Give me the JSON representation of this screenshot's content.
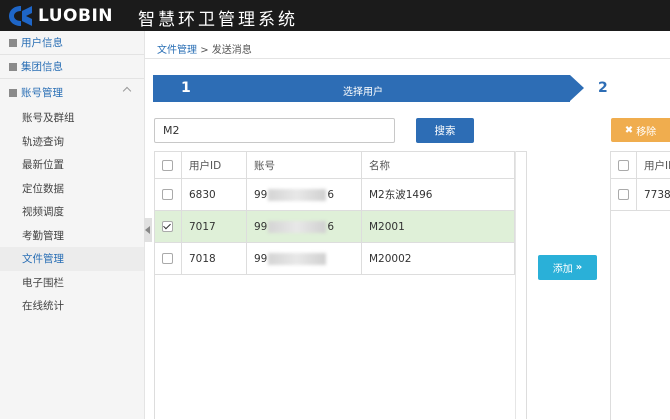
{
  "header": {
    "brand": "LUOBIN",
    "title": "智慧环卫管理系统"
  },
  "sidebar": {
    "top_items": [
      {
        "label": "用户信息"
      },
      {
        "label": "集团信息"
      }
    ],
    "group": {
      "label": "账号管理"
    },
    "items": [
      {
        "label": "账号及群组"
      },
      {
        "label": "轨迹查询"
      },
      {
        "label": "最新位置"
      },
      {
        "label": "定位数据"
      },
      {
        "label": "视频调度"
      },
      {
        "label": "考勤管理"
      },
      {
        "label": "文件管理"
      },
      {
        "label": "电子围栏"
      },
      {
        "label": "在线统计"
      }
    ]
  },
  "breadcrumb": {
    "parent": "文件管理",
    "separator": ">",
    "current": "发送消息"
  },
  "steps": {
    "step1_num": "1",
    "step1_label": "选择用户",
    "step2_num": "2"
  },
  "search": {
    "value": "M2",
    "button": "搜索"
  },
  "buttons": {
    "add": "添加",
    "remove": "移除"
  },
  "left_table": {
    "headers": [
      "用户ID",
      "账号",
      "名称"
    ],
    "rows": [
      {
        "id": "6830",
        "acc_pre": "99",
        "acc_suf": "6",
        "name": "M2东波1496",
        "checked": false
      },
      {
        "id": "7017",
        "acc_pre": "99",
        "acc_suf": "6",
        "name": "M2001",
        "checked": true
      },
      {
        "id": "7018",
        "acc_pre": "99",
        "acc_suf": "",
        "name": "M20002",
        "checked": false
      }
    ]
  },
  "right_table": {
    "headers": [
      "用户ID"
    ],
    "rows": [
      {
        "id": "7738"
      }
    ]
  },
  "colors": {
    "topbar": "#1b1b1b",
    "primary": "#2d6db5",
    "warning": "#f0ad4e",
    "info": "#2ab0d8",
    "selected_row": "#dff0d8"
  }
}
